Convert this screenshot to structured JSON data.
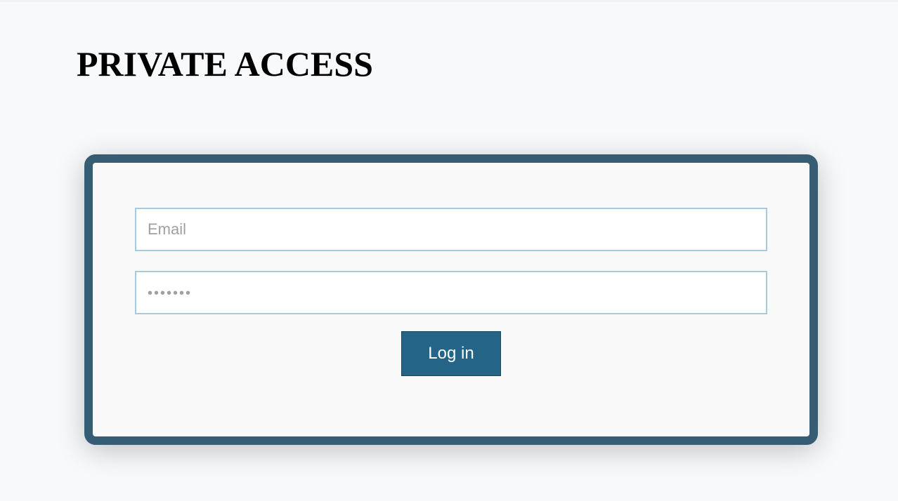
{
  "page": {
    "title": "PRIVATE ACCESS"
  },
  "login_form": {
    "email": {
      "value": "",
      "placeholder": "Email"
    },
    "password": {
      "value": "",
      "placeholder": "•••••••"
    },
    "submit_label": "Log in"
  },
  "colors": {
    "background": "#f8f9fa",
    "card_border": "#365d73",
    "card_fill": "#f9f9f9",
    "input_border": "#a8cadc",
    "button_fill": "#246486",
    "button_text": "#ffffff"
  }
}
